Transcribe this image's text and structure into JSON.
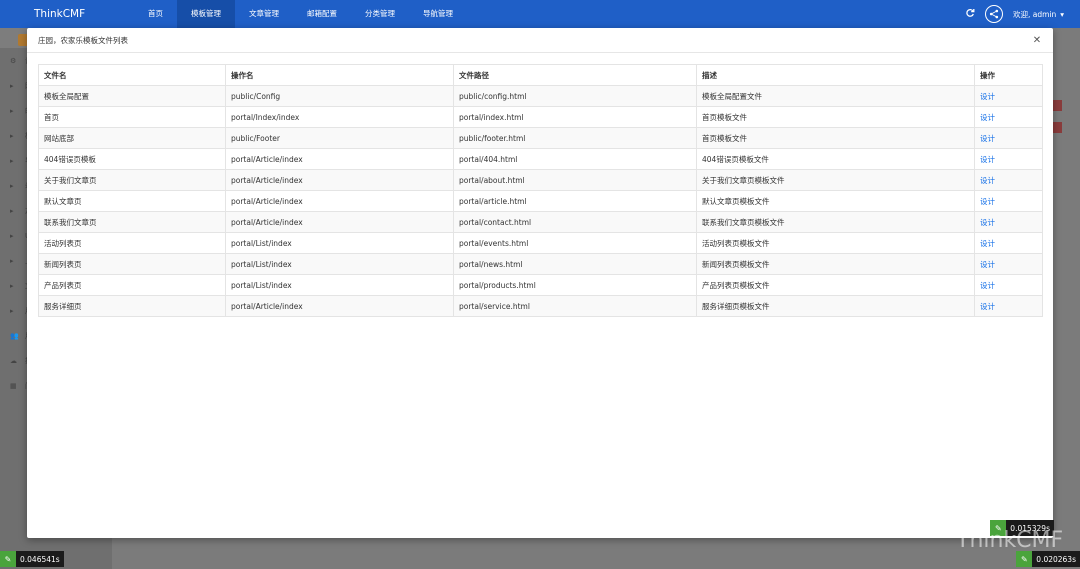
{
  "brand": "ThinkCMF",
  "topnav": [
    {
      "label": "首页"
    },
    {
      "label": "模板管理"
    },
    {
      "label": "文章管理"
    },
    {
      "label": "邮箱配置"
    },
    {
      "label": "分类管理"
    },
    {
      "label": "导航管理"
    }
  ],
  "user": {
    "label": "欢迎, admin"
  },
  "modal": {
    "title": "庄园，农家乐模板文件列表",
    "columns": [
      "文件名",
      "操作名",
      "文件路径",
      "描述",
      "操作"
    ],
    "rows": [
      {
        "name": "模板全局配置",
        "action": "public/Config",
        "path": "public/config.html",
        "desc": "模板全局配置文件",
        "op": "设计"
      },
      {
        "name": "首页",
        "action": "portal/Index/index",
        "path": "portal/index.html",
        "desc": "首页模板文件",
        "op": "设计"
      },
      {
        "name": "网站底部",
        "action": "public/Footer",
        "path": "public/footer.html",
        "desc": "首页模板文件",
        "op": "设计"
      },
      {
        "name": "404错误页模板",
        "action": "portal/Article/index",
        "path": "portal/404.html",
        "desc": "404错误页模板文件",
        "op": "设计"
      },
      {
        "name": "关于我们文章页",
        "action": "portal/Article/index",
        "path": "portal/about.html",
        "desc": "关于我们文章页模板文件",
        "op": "设计"
      },
      {
        "name": "默认文章页",
        "action": "portal/Article/index",
        "path": "portal/article.html",
        "desc": "默认文章页模板文件",
        "op": "设计"
      },
      {
        "name": "联系我们文章页",
        "action": "portal/Article/index",
        "path": "portal/contact.html",
        "desc": "联系我们文章页模板文件",
        "op": "设计"
      },
      {
        "name": "活动列表页",
        "action": "portal/List/index",
        "path": "portal/events.html",
        "desc": "活动列表页模板文件",
        "op": "设计"
      },
      {
        "name": "新闻列表页",
        "action": "portal/List/index",
        "path": "portal/news.html",
        "desc": "新闻列表页模板文件",
        "op": "设计"
      },
      {
        "name": "产品列表页",
        "action": "portal/List/index",
        "path": "portal/products.html",
        "desc": "产品列表页模板文件",
        "op": "设计"
      },
      {
        "name": "服务详细页",
        "action": "portal/Article/index",
        "path": "portal/service.html",
        "desc": "服务详细页模板文件",
        "op": "设计"
      }
    ]
  },
  "sidebar": [
    {
      "icon": "gear-icon",
      "label": "设"
    },
    {
      "icon": "caret-right-icon",
      "label": "网"
    },
    {
      "icon": "caret-right-icon",
      "label": "邮"
    },
    {
      "icon": "caret-right-icon",
      "label": "模"
    },
    {
      "icon": "caret-right-icon",
      "label": "导"
    },
    {
      "icon": "caret-right-icon",
      "label": "幻"
    },
    {
      "icon": "caret-right-icon",
      "label": "友"
    },
    {
      "icon": "caret-right-icon",
      "label": "U"
    },
    {
      "icon": "caret-right-icon",
      "label": "上"
    },
    {
      "icon": "caret-right-icon",
      "label": "文"
    },
    {
      "icon": "caret-right-icon",
      "label": "用"
    },
    {
      "icon": "users-icon",
      "label": "用"
    },
    {
      "icon": "cloud-icon",
      "label": "插"
    },
    {
      "icon": "grid-icon",
      "label": "门"
    }
  ],
  "timings": {
    "modal": "0.015329s",
    "left": "0.046541s",
    "right": "0.020263s"
  },
  "watermark": "ThinkCMF",
  "colors": {
    "navbar": "#1f5fc7",
    "link": "#1a73e8",
    "badge_leaf": "#4aa43c"
  }
}
